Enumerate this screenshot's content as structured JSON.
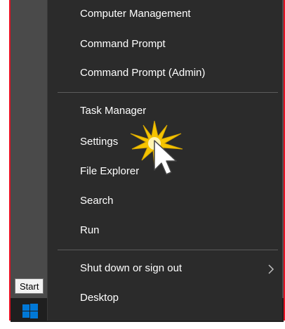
{
  "context_menu": {
    "items": [
      {
        "label": "Computer Management"
      },
      {
        "label": "Command Prompt"
      },
      {
        "label": "Command Prompt (Admin)"
      },
      {
        "label": "Task Manager"
      },
      {
        "label": "Settings"
      },
      {
        "label": "File Explorer"
      },
      {
        "label": "Search"
      },
      {
        "label": "Run"
      },
      {
        "label": "Shut down or sign out",
        "submenu_indicator": "chevron-right-icon"
      },
      {
        "label": "Desktop"
      }
    ]
  },
  "taskbar": {
    "start_tooltip": "Start",
    "start_icon": "windows-logo-icon"
  },
  "colors": {
    "menu_background": "#2b2b2b",
    "menu_text": "#ffffff",
    "highlight_border": "#e81123",
    "start_logo": "#0078d7",
    "click_burst": "#f5c400"
  }
}
